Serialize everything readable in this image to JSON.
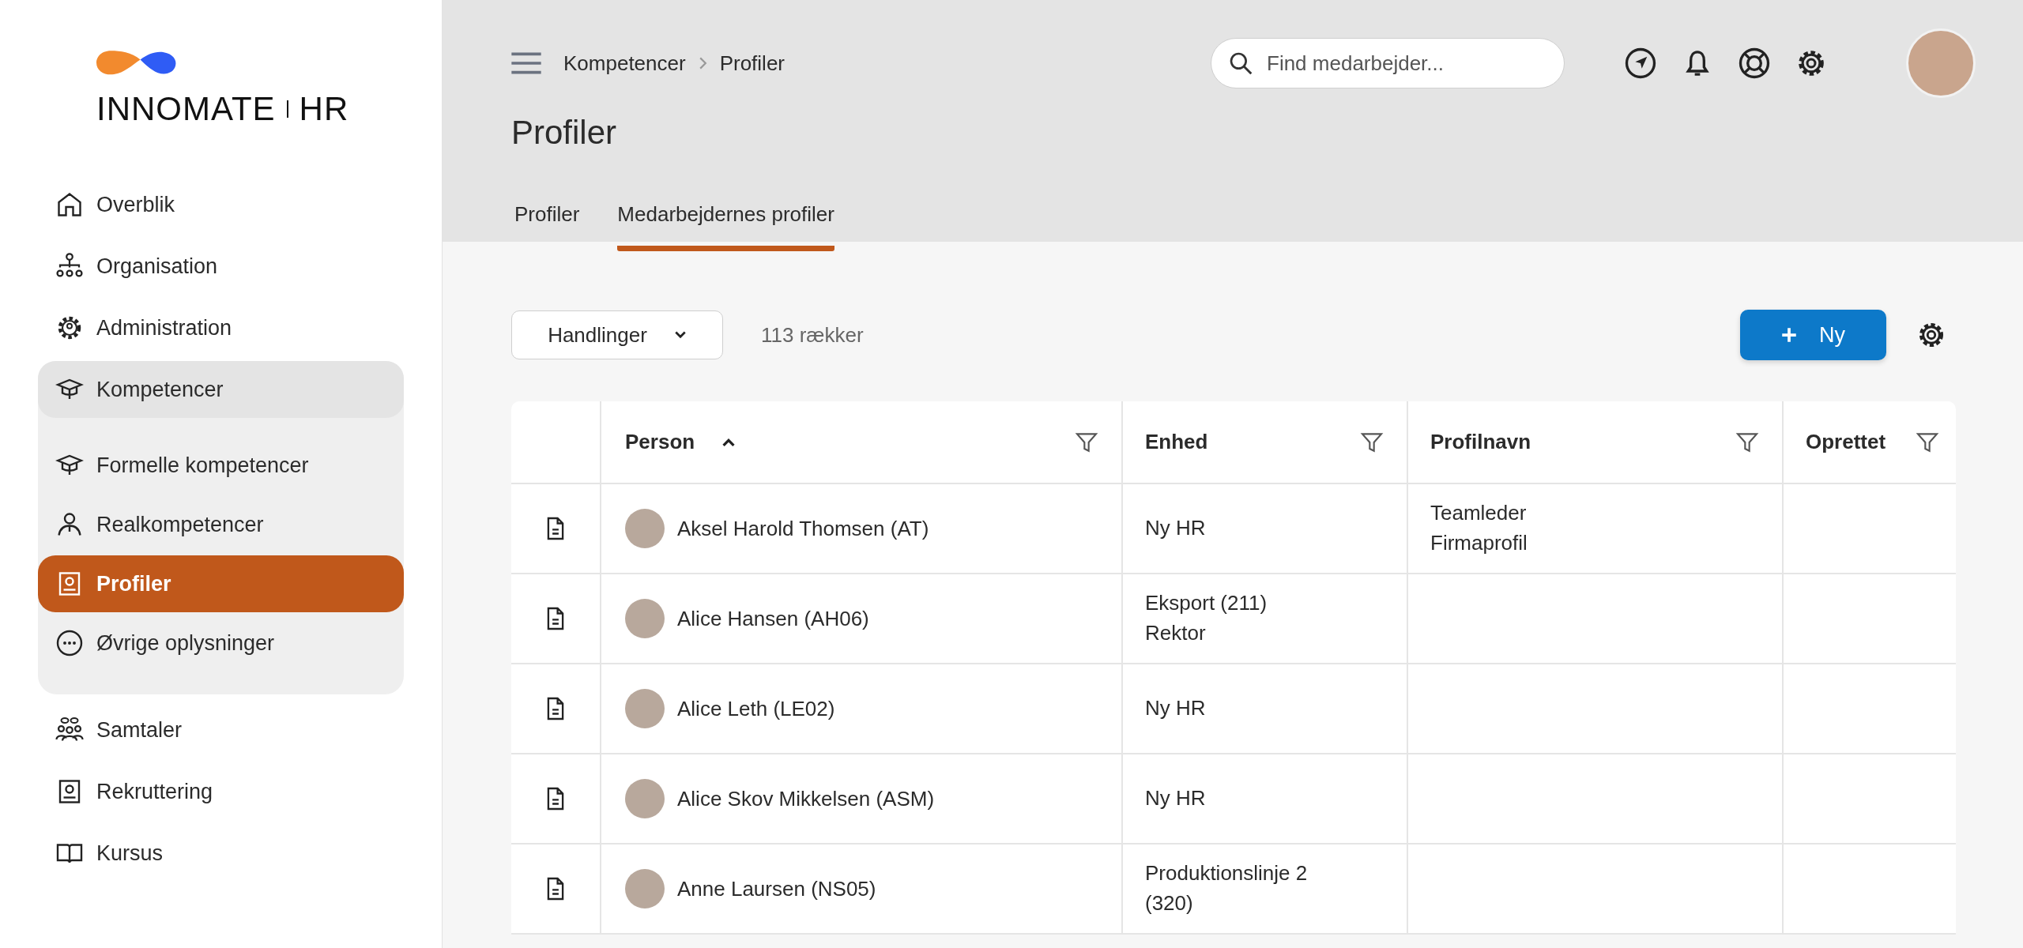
{
  "logo": {
    "light": "INNO",
    "bold": "MATE",
    "suffix": "HR"
  },
  "sidebar": {
    "items": [
      {
        "label": "Overblik",
        "selected": false
      },
      {
        "label": "Organisation",
        "selected": false
      },
      {
        "label": "Administration",
        "selected": false
      },
      {
        "label": "Kompetencer",
        "selected": false,
        "expanded": true,
        "children": [
          {
            "label": "Formelle kompetencer",
            "selected": false
          },
          {
            "label": "Realkompetencer",
            "selected": false
          },
          {
            "label": "Profiler",
            "selected": true
          },
          {
            "label": "Øvrige oplysninger",
            "selected": false
          }
        ]
      },
      {
        "label": "Samtaler",
        "selected": false
      },
      {
        "label": "Rekruttering",
        "selected": false
      },
      {
        "label": "Kursus",
        "selected": false
      }
    ]
  },
  "breadcrumb": [
    "Kompetencer",
    "Profiler"
  ],
  "search": {
    "placeholder": "Find medarbejder..."
  },
  "page_title": "Profiler",
  "tabs": [
    {
      "label": "Profiler",
      "selected": false
    },
    {
      "label": "Medarbejdernes profiler",
      "selected": true
    }
  ],
  "toolbar": {
    "actions": "Handlinger",
    "row_count": "113 rækker",
    "new_button": "Ny"
  },
  "table": {
    "columns": [
      {
        "label": "Person",
        "sorted_ascending": true
      },
      {
        "label": "Enhed",
        "sorted_ascending": false
      },
      {
        "label": "Profilnavn",
        "sorted_ascending": false
      },
      {
        "label": "Oprettet",
        "sorted_ascending": false
      }
    ],
    "rows": [
      {
        "person": "Aksel Harold Thomsen (AT)",
        "unit": [
          "Ny HR"
        ],
        "profiles": [
          "Teamleder",
          "Firmaprofil"
        ]
      },
      {
        "person": "Alice Hansen (AH06)",
        "unit": [
          "Eksport (211)",
          "Rektor"
        ],
        "profiles": []
      },
      {
        "person": "Alice Leth (LE02)",
        "unit": [
          "Ny HR"
        ],
        "profiles": []
      },
      {
        "person": "Alice Skov Mikkelsen (ASM)",
        "unit": [
          "Ny HR"
        ],
        "profiles": []
      },
      {
        "person": "Anne Laursen (NS05)",
        "unit": [
          "Produktionslinje 2 (320)"
        ],
        "profiles": []
      }
    ]
  }
}
